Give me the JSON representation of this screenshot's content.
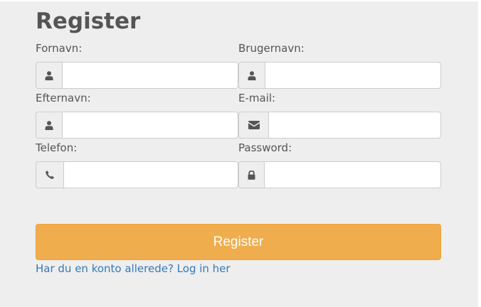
{
  "form": {
    "title": "Register",
    "fields": {
      "first_name": {
        "label": "Fornavn:",
        "value": "",
        "placeholder": "",
        "icon": "user-icon"
      },
      "username": {
        "label": "Brugernavn:",
        "value": "",
        "placeholder": "",
        "icon": "user-icon"
      },
      "last_name": {
        "label": "Efternavn:",
        "value": "",
        "placeholder": "",
        "icon": "user-icon"
      },
      "email": {
        "label": "E-mail:",
        "value": "",
        "placeholder": "",
        "icon": "envelope-icon"
      },
      "phone": {
        "label": "Telefon:",
        "value": "",
        "placeholder": "",
        "icon": "phone-icon"
      },
      "password": {
        "label": "Password:",
        "value": "",
        "placeholder": "",
        "icon": "lock-icon"
      }
    },
    "submit_label": "Register",
    "login_link_text": "Har du en konto allerede? Log in her"
  },
  "colors": {
    "background": "#eeeeee",
    "button": "#f0ad4e",
    "link": "#337ab7",
    "text": "#555555"
  }
}
